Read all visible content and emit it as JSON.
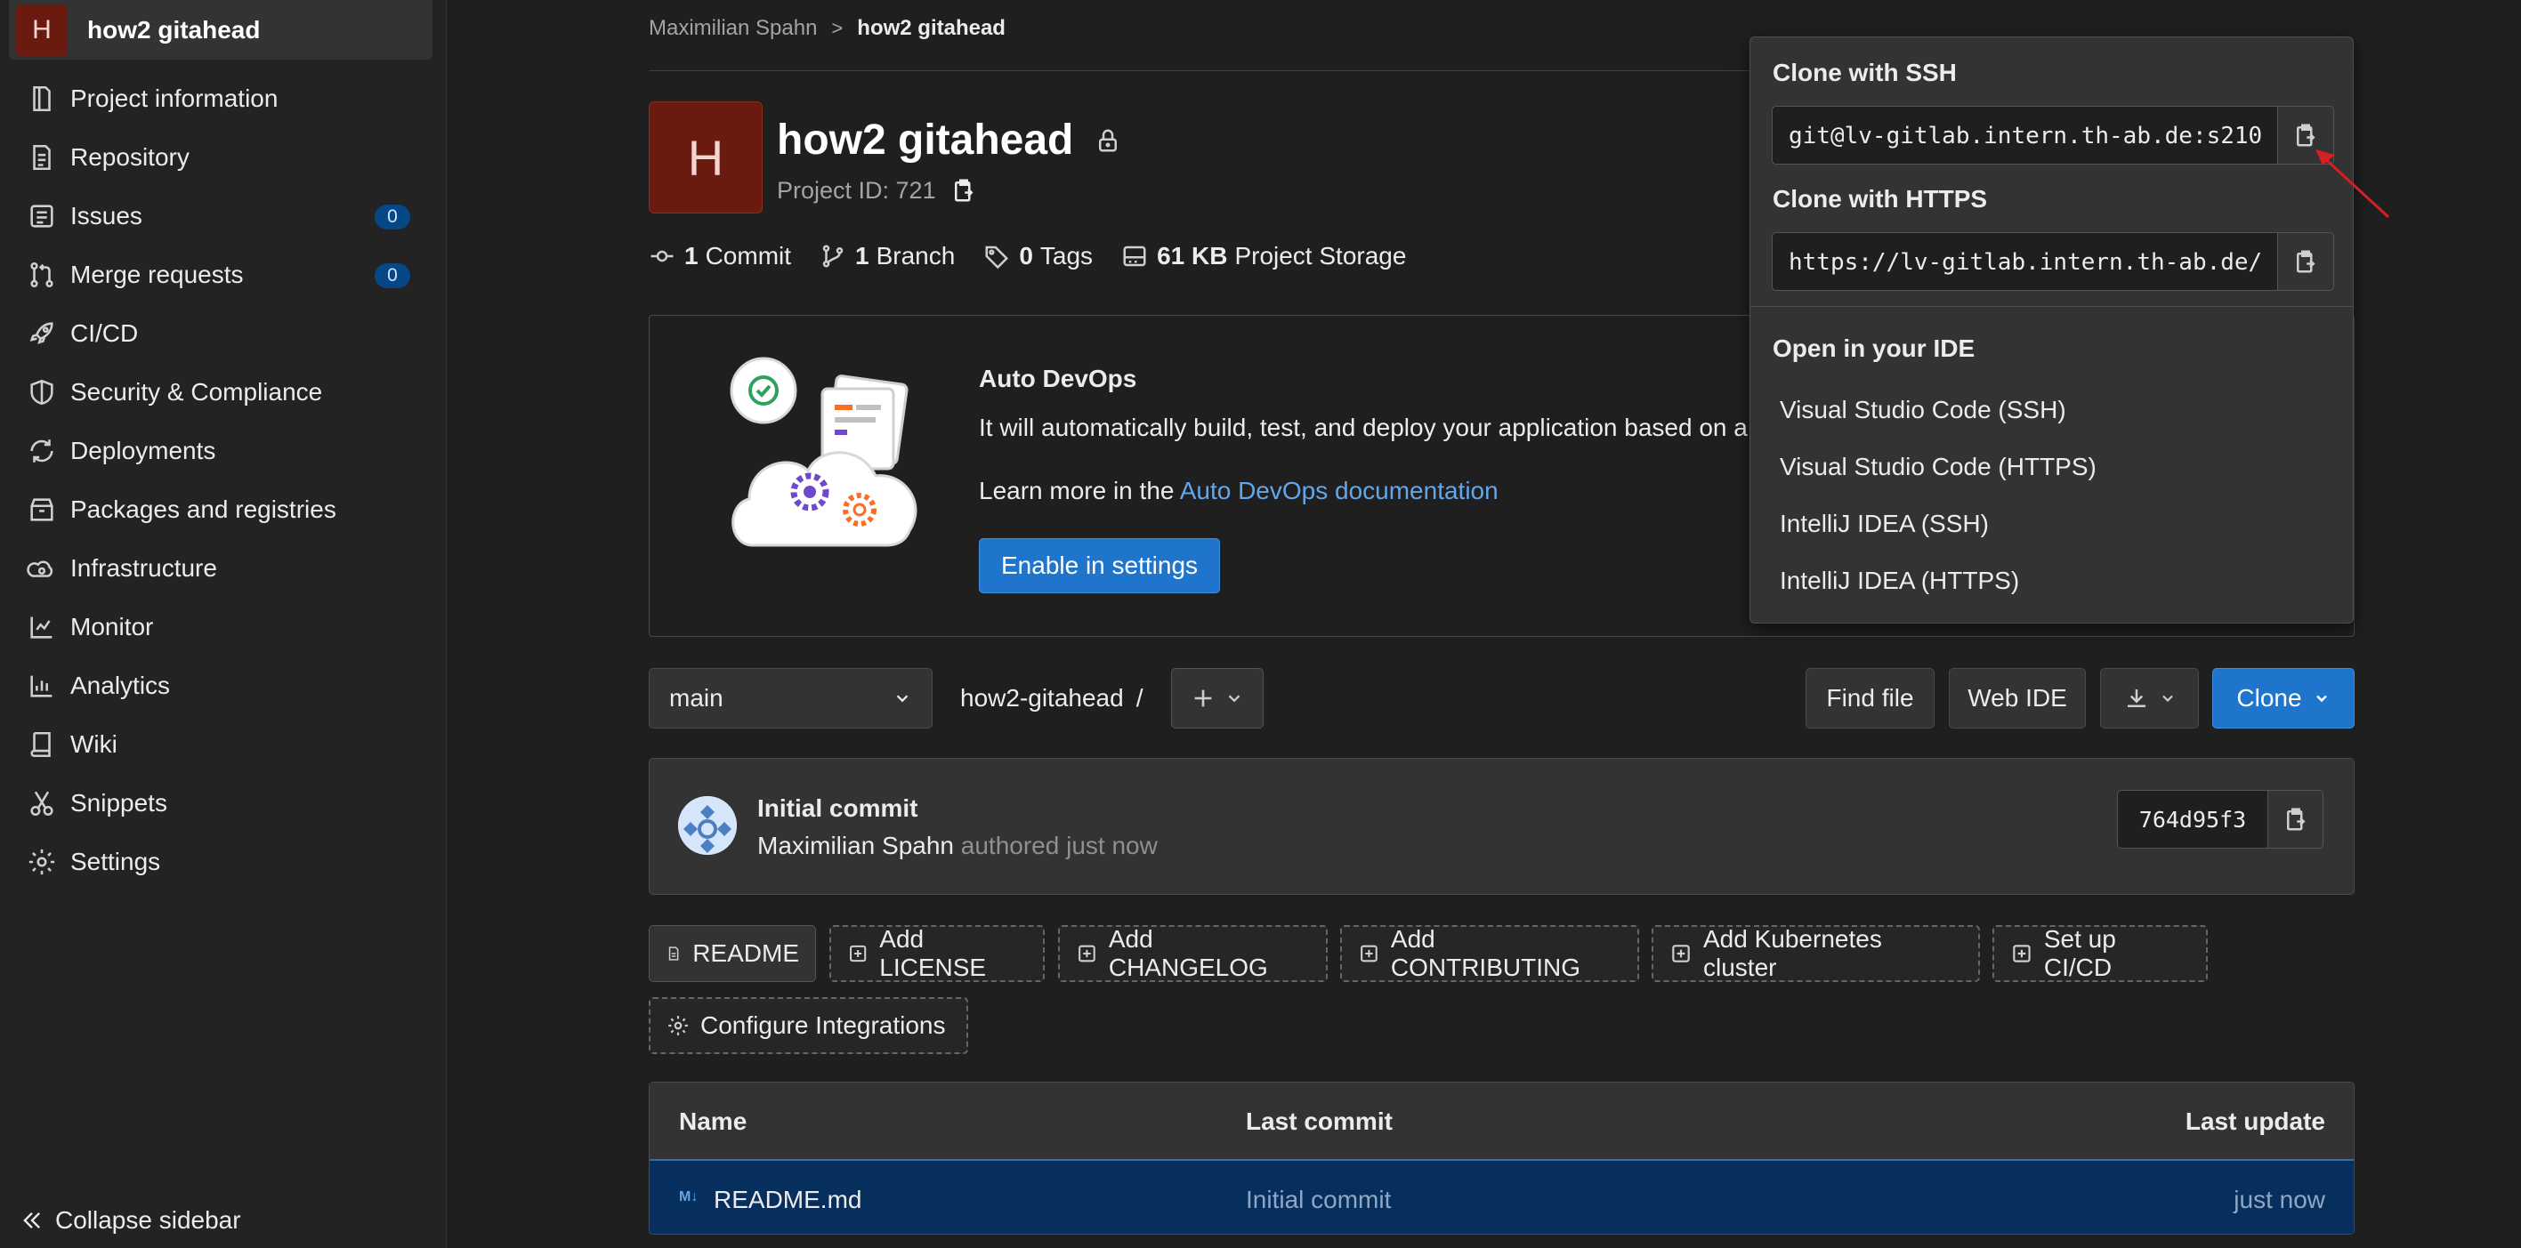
{
  "sidebar": {
    "project_initial": "H",
    "project_name": "how2 gitahead",
    "items": [
      {
        "label": "Project information",
        "icon": "project-info-icon"
      },
      {
        "label": "Repository",
        "icon": "repository-icon"
      },
      {
        "label": "Issues",
        "icon": "issues-icon",
        "badge": "0"
      },
      {
        "label": "Merge requests",
        "icon": "merge-request-icon",
        "badge": "0"
      },
      {
        "label": "CI/CD",
        "icon": "rocket-icon"
      },
      {
        "label": "Security & Compliance",
        "icon": "shield-icon"
      },
      {
        "label": "Deployments",
        "icon": "deployments-icon"
      },
      {
        "label": "Packages and registries",
        "icon": "package-icon"
      },
      {
        "label": "Infrastructure",
        "icon": "cloud-gear-icon"
      },
      {
        "label": "Monitor",
        "icon": "monitor-icon"
      },
      {
        "label": "Analytics",
        "icon": "chart-icon"
      },
      {
        "label": "Wiki",
        "icon": "book-icon"
      },
      {
        "label": "Snippets",
        "icon": "scissors-icon"
      },
      {
        "label": "Settings",
        "icon": "gear-icon"
      }
    ],
    "collapse_label": "Collapse sidebar"
  },
  "breadcrumb": {
    "parent": "Maximilian Spahn",
    "separator": ">",
    "current": "how2 gitahead"
  },
  "project": {
    "initial": "H",
    "title": "how2 gitahead",
    "id_text": "Project ID: 721"
  },
  "stats": {
    "commits_num": "1",
    "commits_label": "Commit",
    "branches_num": "1",
    "branches_label": "Branch",
    "tags_num": "0",
    "tags_label": "Tags",
    "storage_num": "61 KB",
    "storage_label": "Project Storage"
  },
  "devops": {
    "title": "Auto DevOps",
    "description": "It will automatically build, test, and deploy your application based on a",
    "learn_prefix": "Learn more in the ",
    "learn_link": "Auto DevOps documentation",
    "enable_label": "Enable in settings"
  },
  "toolbar": {
    "branch": "main",
    "repo_path": "how2-gitahead",
    "path_sep": "/",
    "find_file": "Find file",
    "web_ide": "Web IDE",
    "clone": "Clone"
  },
  "commit": {
    "title": "Initial commit",
    "author": "Maximilian Spahn",
    "meta": "authored just now",
    "sha": "764d95f3"
  },
  "quick_actions": {
    "readme": "README",
    "license": "Add LICENSE",
    "changelog": "Add CHANGELOG",
    "contributing": "Add CONTRIBUTING",
    "kubernetes": "Add Kubernetes cluster",
    "cicd": "Set up CI/CD",
    "integrations": "Configure Integrations"
  },
  "files": {
    "headers": {
      "name": "Name",
      "last_commit": "Last commit",
      "last_update": "Last update"
    },
    "rows": [
      {
        "name": "README.md",
        "last_commit": "Initial commit",
        "last_update": "just now"
      }
    ]
  },
  "clone_dropdown": {
    "ssh_title": "Clone with SSH",
    "ssh_url": "git@lv-gitlab.intern.th-ab.de:s210",
    "https_title": "Clone with HTTPS",
    "https_url": "https://lv-gitlab.intern.th-ab.de/",
    "ide_title": "Open in your IDE",
    "ide_items": [
      "Visual Studio Code (SSH)",
      "Visual Studio Code (HTTPS)",
      "IntelliJ IDEA (SSH)",
      "IntelliJ IDEA (HTTPS)"
    ]
  },
  "colors": {
    "accent": "#1f75cb",
    "project_avatar": "#6b1a10",
    "selected_row": "#062f5e",
    "annotation_arrow": "#d42020"
  }
}
